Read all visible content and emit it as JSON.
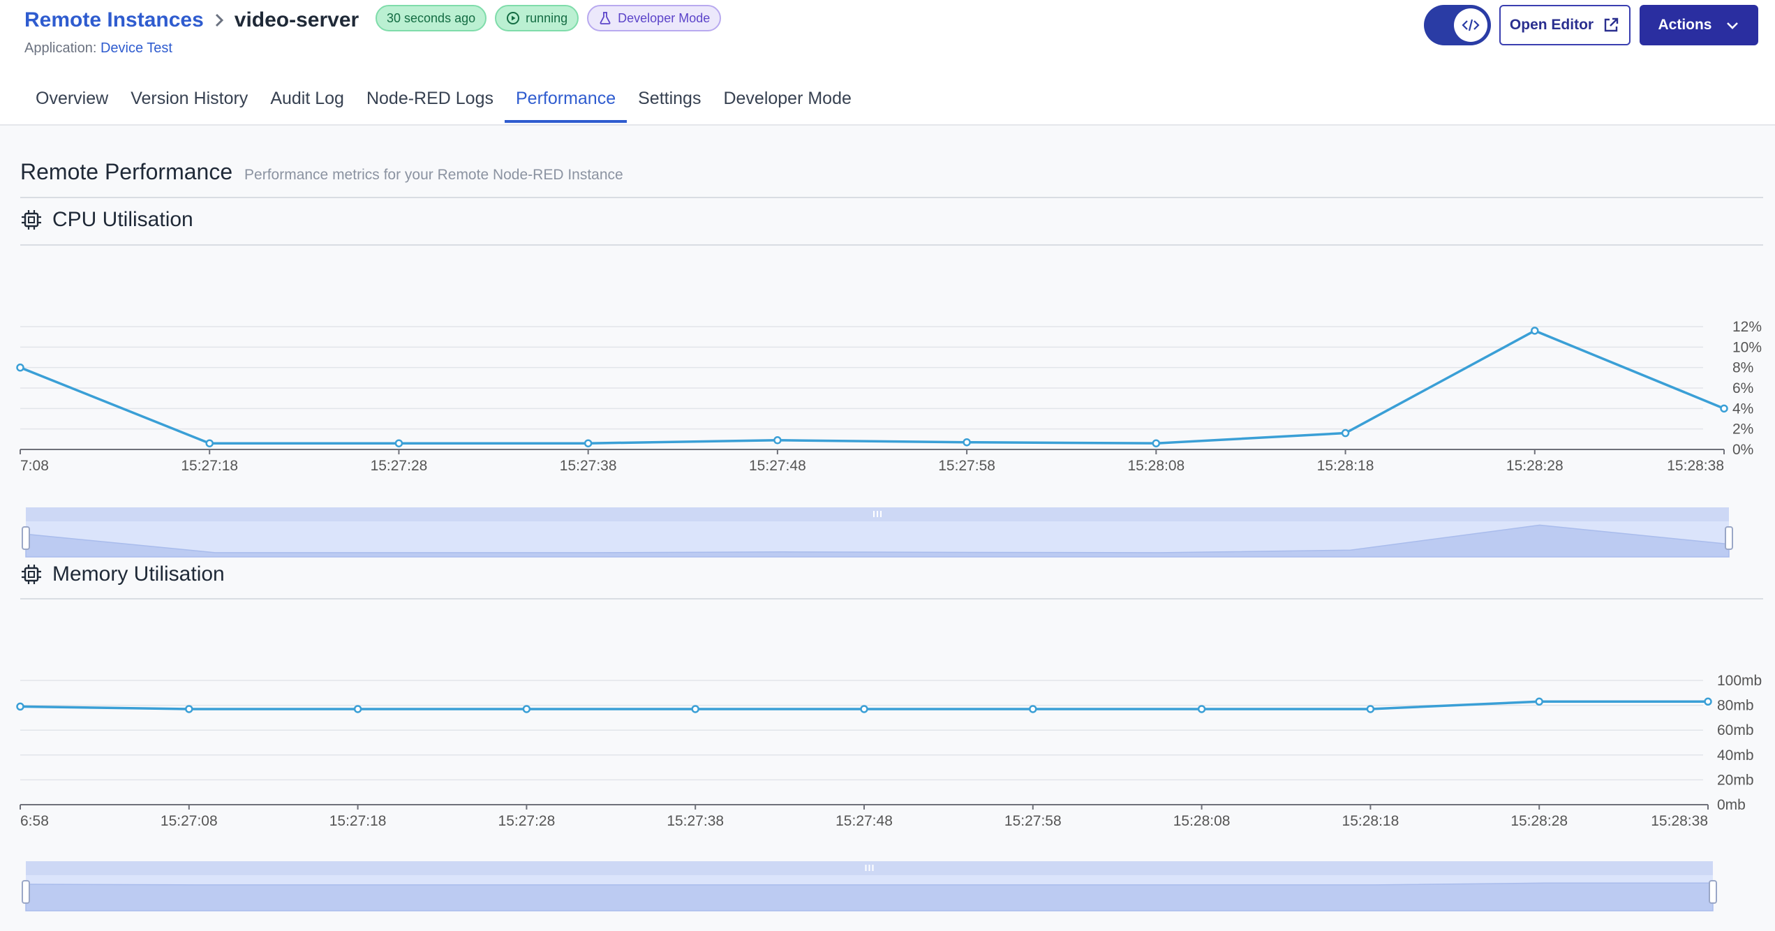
{
  "breadcrumb": {
    "parent": "Remote Instances",
    "current": "video-server"
  },
  "badges": {
    "updated": "30 seconds ago",
    "status": "running",
    "mode": "Developer Mode"
  },
  "application": {
    "label": "Application:",
    "value": "Device Test"
  },
  "buttons": {
    "open_editor": "Open Editor",
    "actions": "Actions"
  },
  "tabs": [
    "Overview",
    "Version History",
    "Audit Log",
    "Node-RED Logs",
    "Performance",
    "Settings",
    "Developer Mode"
  ],
  "active_tab": "Performance",
  "section": {
    "title": "Remote Performance",
    "subtitle": "Performance metrics for your Remote Node-RED Instance"
  },
  "colors": {
    "accent": "#2f5ccf",
    "line": "#3a9fd6",
    "slider": "#dbe4fb"
  },
  "chart_data": [
    {
      "type": "line",
      "title": "CPU Utilisation",
      "categories": [
        "7:08",
        "15:27:18",
        "15:27:28",
        "15:27:38",
        "15:27:48",
        "15:27:58",
        "15:28:08",
        "15:28:18",
        "15:28:28",
        "15:28:38"
      ],
      "values": [
        8.0,
        0.6,
        0.6,
        0.6,
        0.9,
        0.7,
        0.6,
        1.6,
        11.6,
        4.0
      ],
      "yticks": [
        "0%",
        "2%",
        "4%",
        "6%",
        "8%",
        "10%",
        "12%"
      ],
      "ylim": [
        0,
        12
      ],
      "y_axis_position": "right",
      "grid": true,
      "zoom_slider": true
    },
    {
      "type": "line",
      "title": "Memory Utilisation",
      "categories": [
        "6:58",
        "15:27:08",
        "15:27:18",
        "15:27:28",
        "15:27:38",
        "15:27:48",
        "15:27:58",
        "15:28:08",
        "15:28:18",
        "15:28:28",
        "15:28:38"
      ],
      "values": [
        79,
        77,
        77,
        77,
        77,
        77,
        77,
        77,
        77,
        83,
        83
      ],
      "yticks": [
        "0mb",
        "20mb",
        "40mb",
        "60mb",
        "80mb",
        "100mb"
      ],
      "ylim": [
        0,
        100
      ],
      "y_axis_position": "right",
      "grid": true,
      "zoom_slider": true
    }
  ]
}
